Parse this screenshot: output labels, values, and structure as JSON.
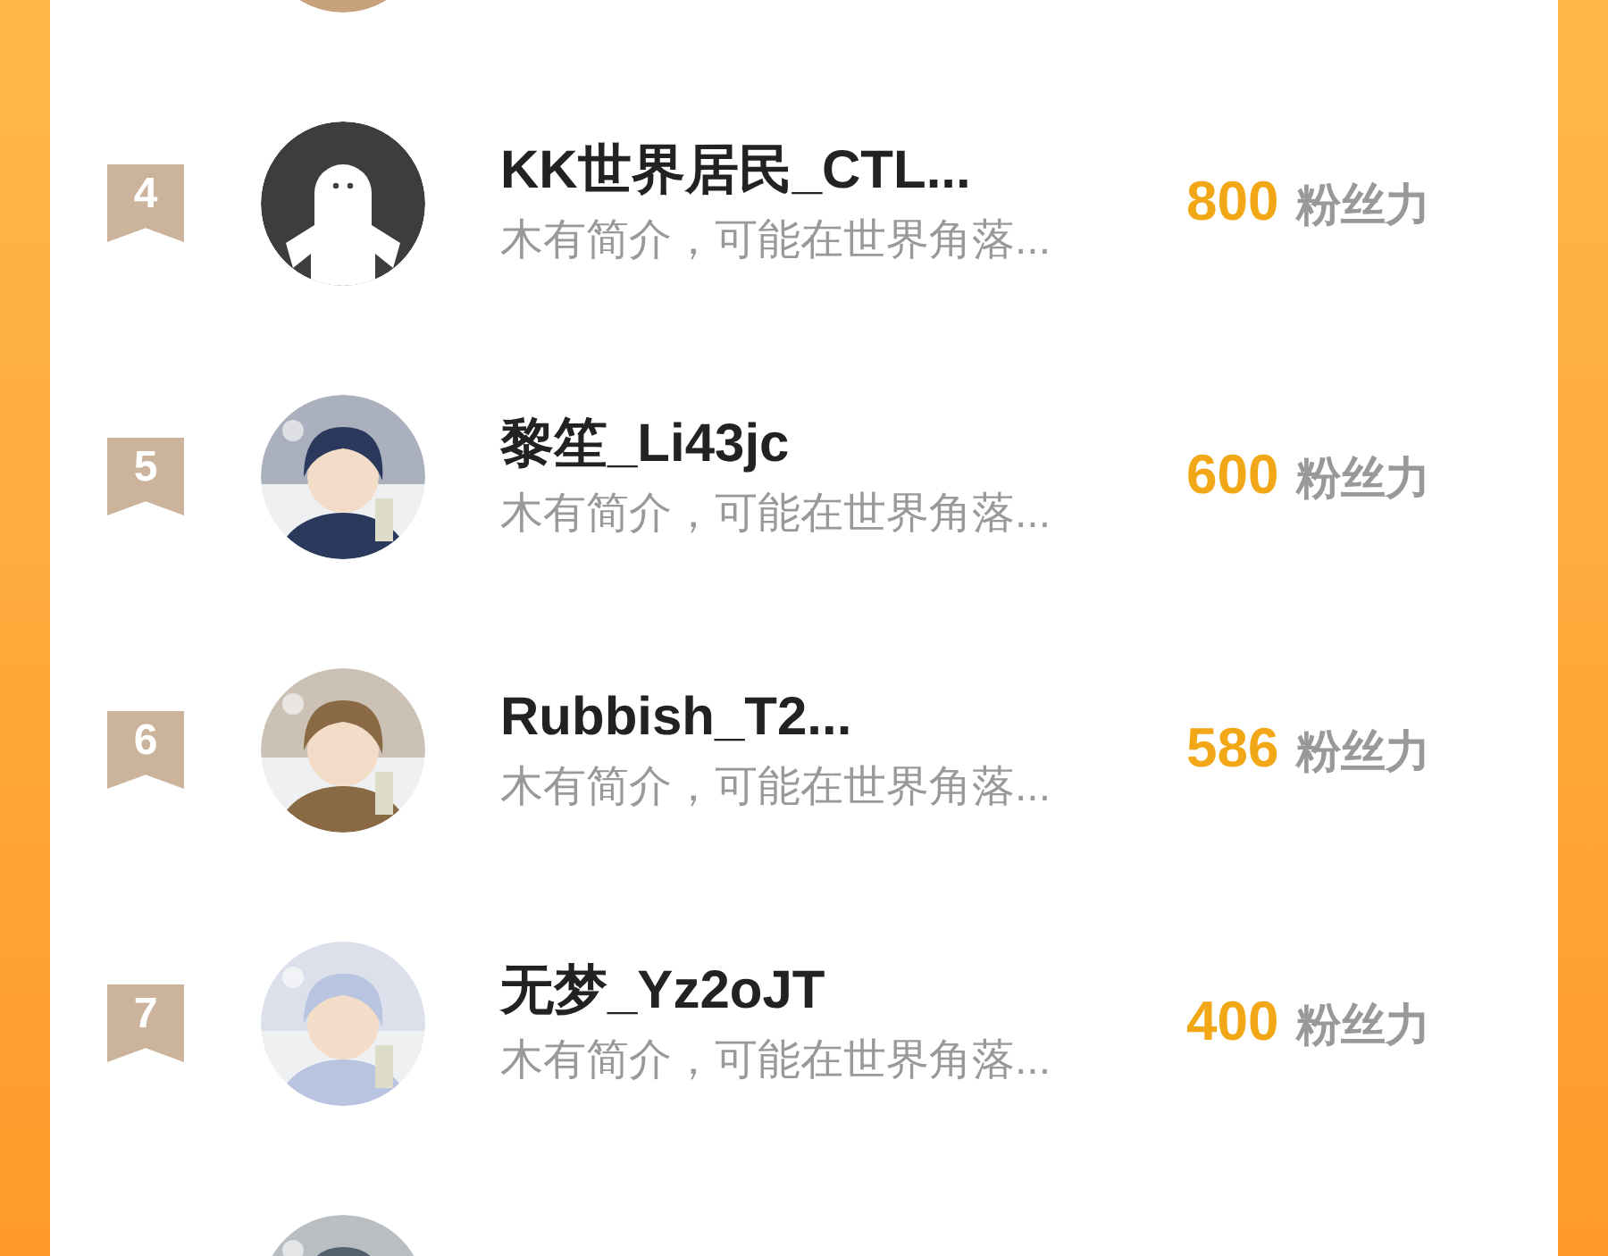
{
  "rows": [
    {
      "avatar": {
        "kind": "picture"
      }
    },
    {
      "rank": "4",
      "avatar": {
        "kind": "default"
      },
      "name": "KK世界居民_CTL...",
      "bio": "木有简介，可能在世界角落...",
      "score": "800",
      "unit": "粉丝力"
    },
    {
      "rank": "5",
      "avatar": {
        "kind": "picture"
      },
      "name": "黎笙_Li43jc",
      "bio": "木有简介，可能在世界角落...",
      "score": "600",
      "unit": "粉丝力"
    },
    {
      "rank": "6",
      "avatar": {
        "kind": "picture"
      },
      "name": "Rubbish_T2...",
      "bio": "木有简介，可能在世界角落...",
      "score": "586",
      "unit": "粉丝力"
    },
    {
      "rank": "7",
      "avatar": {
        "kind": "picture"
      },
      "name": "无梦_Yz2oJT",
      "bio": "木有简介，可能在世界角落...",
      "score": "400",
      "unit": "粉丝力"
    },
    {
      "avatar": {
        "kind": "picture"
      }
    }
  ]
}
